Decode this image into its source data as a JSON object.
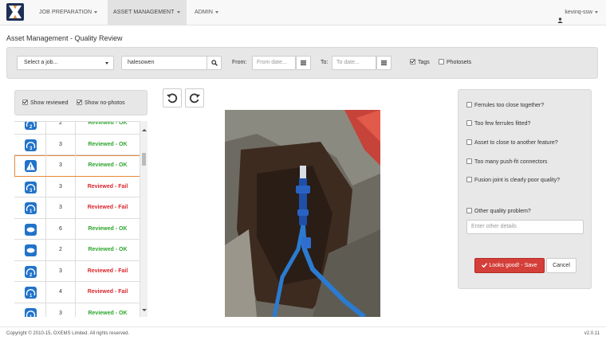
{
  "nav": {
    "items": [
      {
        "label": "JOB PREPARATION"
      },
      {
        "label": "ASSET MANAGEMENT"
      },
      {
        "label": "ADMIN"
      }
    ],
    "user": "kevinq-ssw"
  },
  "page_title": "Asset Management - Quality Review",
  "filters": {
    "job_select": "Select a job...",
    "search_value": "halesowen",
    "from_label": "From:",
    "from_placeholder": "From date...",
    "to_label": "To:",
    "to_placeholder": "To date...",
    "tags_label": "Tags",
    "tags_checked": true,
    "photosets_label": "Photosets",
    "photosets_checked": false
  },
  "left_options": {
    "show_reviewed": "Show reviewed",
    "show_no_photos": "Show no-photos"
  },
  "table_rows": [
    {
      "icon": "gauge-2-icon",
      "count": "2",
      "status": "Reviewed - OK",
      "state": "ok"
    },
    {
      "icon": "gauge-3-icon",
      "count": "3",
      "status": "Reviewed - OK",
      "state": "ok"
    },
    {
      "icon": "warning-icon",
      "count": "3",
      "status": "Reviewed - OK",
      "state": "ok",
      "selected": true
    },
    {
      "icon": "gauge-3-icon",
      "count": "3",
      "status": "Reviewed - Fail",
      "state": "fail"
    },
    {
      "icon": "gauge-1-icon",
      "count": "3",
      "status": "Reviewed - Fail",
      "state": "fail"
    },
    {
      "icon": "oval-icon",
      "count": "6",
      "status": "Reviewed - OK",
      "state": "ok"
    },
    {
      "icon": "oval-icon",
      "count": "2",
      "status": "Reviewed - OK",
      "state": "ok"
    },
    {
      "icon": "gauge-2-icon",
      "count": "3",
      "status": "Reviewed - Fail",
      "state": "fail"
    },
    {
      "icon": "gauge-1-icon",
      "count": "4",
      "status": "Reviewed - Fail",
      "state": "fail"
    },
    {
      "icon": "gauge-1-icon",
      "count": "3",
      "status": "Reviewed - OK",
      "state": "ok"
    }
  ],
  "quality_checks": [
    "Ferrules too close together?",
    "Too few ferrules fitted?",
    "Asset to close to another feature?",
    "Too many push-fit connectors",
    "Fusion joint is clearly poor quality?"
  ],
  "other_problem": {
    "label": "Other quality problem?",
    "placeholder": "Enter other details"
  },
  "actions": {
    "save": "Looks good! - Save",
    "cancel": "Cancel"
  },
  "footer": {
    "copyright": "Copyright © 2010-15, OXEMS Limited. All rights reserved.",
    "version": "v2.0.11"
  },
  "colors": {
    "ok": "#2ea52e",
    "fail": "#d9262d",
    "primary": "#2173c9",
    "danger": "#d43f3a",
    "selected_outline": "#e8893a"
  }
}
